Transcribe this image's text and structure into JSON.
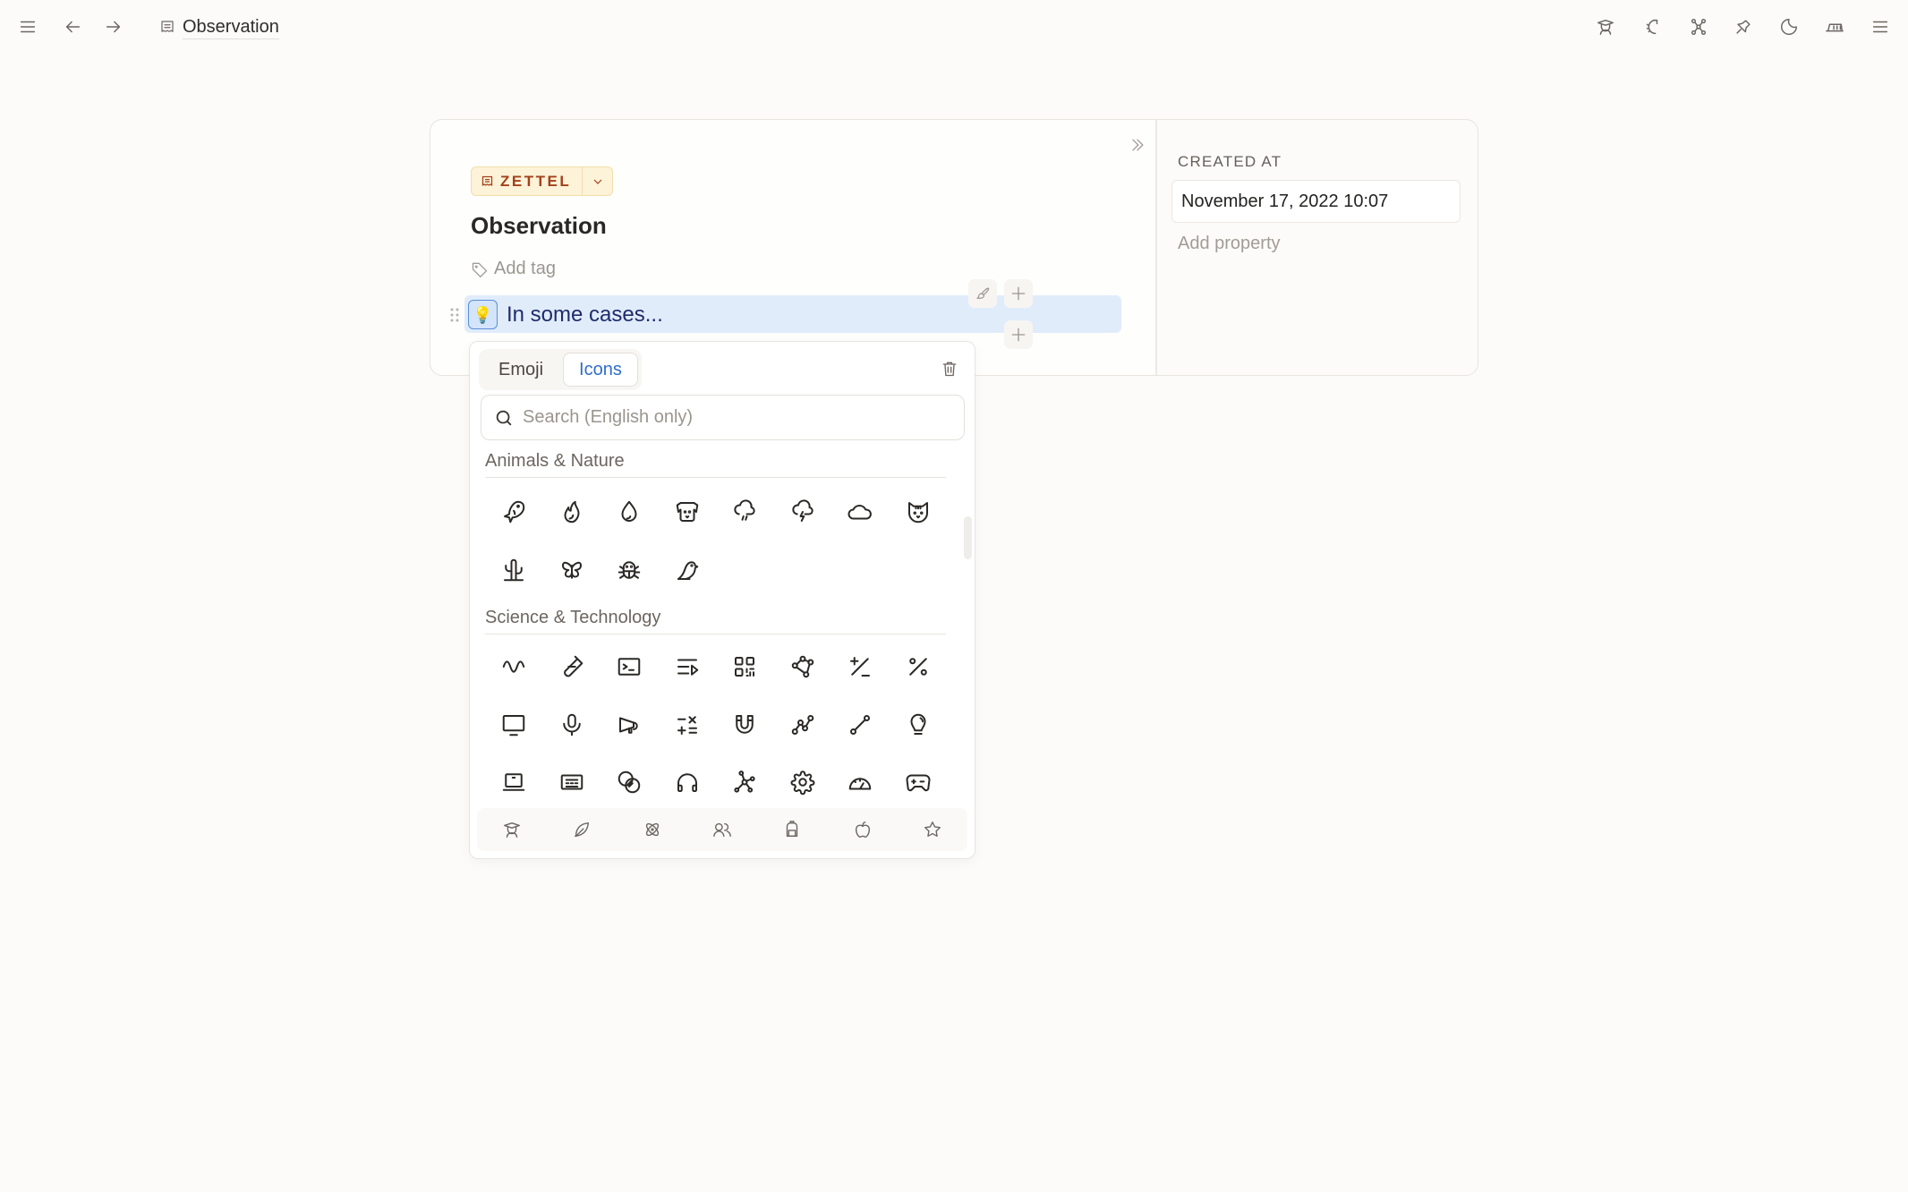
{
  "topbar": {
    "title": "Observation",
    "left_icons": [
      "menu-icon",
      "back-arrow-icon",
      "forward-arrow-icon"
    ],
    "right_icons": [
      "graduation-icon",
      "sparkle-moon-icon",
      "graph-icon",
      "pin-icon",
      "moon-icon",
      "bookshelf-icon",
      "menu-icon"
    ]
  },
  "card": {
    "type_badge": "ZETTEL",
    "title": "Observation",
    "add_tag": "Add tag",
    "block": {
      "icon": "💡",
      "text": "In some cases..."
    },
    "properties": {
      "created_at_label": "CREATED AT",
      "created_at_value": "November 17, 2022 10:07",
      "add_property": "Add property"
    }
  },
  "icon_picker": {
    "tabs": [
      {
        "label": "Emoji",
        "active": false
      },
      {
        "label": "Icons",
        "active": true
      }
    ],
    "search_placeholder": "Search (English only)",
    "sections": [
      {
        "title": "Animals & Nature",
        "icons": [
          "fish",
          "flame",
          "droplet",
          "dog",
          "cloud-rain",
          "cloud-storm",
          "cloud",
          "cat",
          "cactus",
          "butterfly",
          "bug",
          "bird"
        ]
      },
      {
        "title": "Science & Technology",
        "icons": [
          "wave-sine",
          "test-pipe",
          "terminal",
          "playlist",
          "qrcode",
          "polygon",
          "plus-minus",
          "percentage",
          "device-desktop",
          "microphone",
          "speakerphone",
          "math-symbols",
          "magnet",
          "chart-line",
          "line",
          "bulb",
          "device-laptop",
          "keyboard",
          "circles-relation",
          "headphones",
          "affiliate",
          "settings",
          "gauge",
          "device-gamepad"
        ]
      }
    ],
    "category_bar": [
      "school",
      "leaf",
      "atom",
      "users",
      "backpack",
      "apple",
      "star"
    ]
  },
  "colors": {
    "badge_bg": "#fdf3d8",
    "badge_text": "#a3411c",
    "block_highlight": "#e1ecfb",
    "active_tab_text": "#2f6ec8"
  }
}
